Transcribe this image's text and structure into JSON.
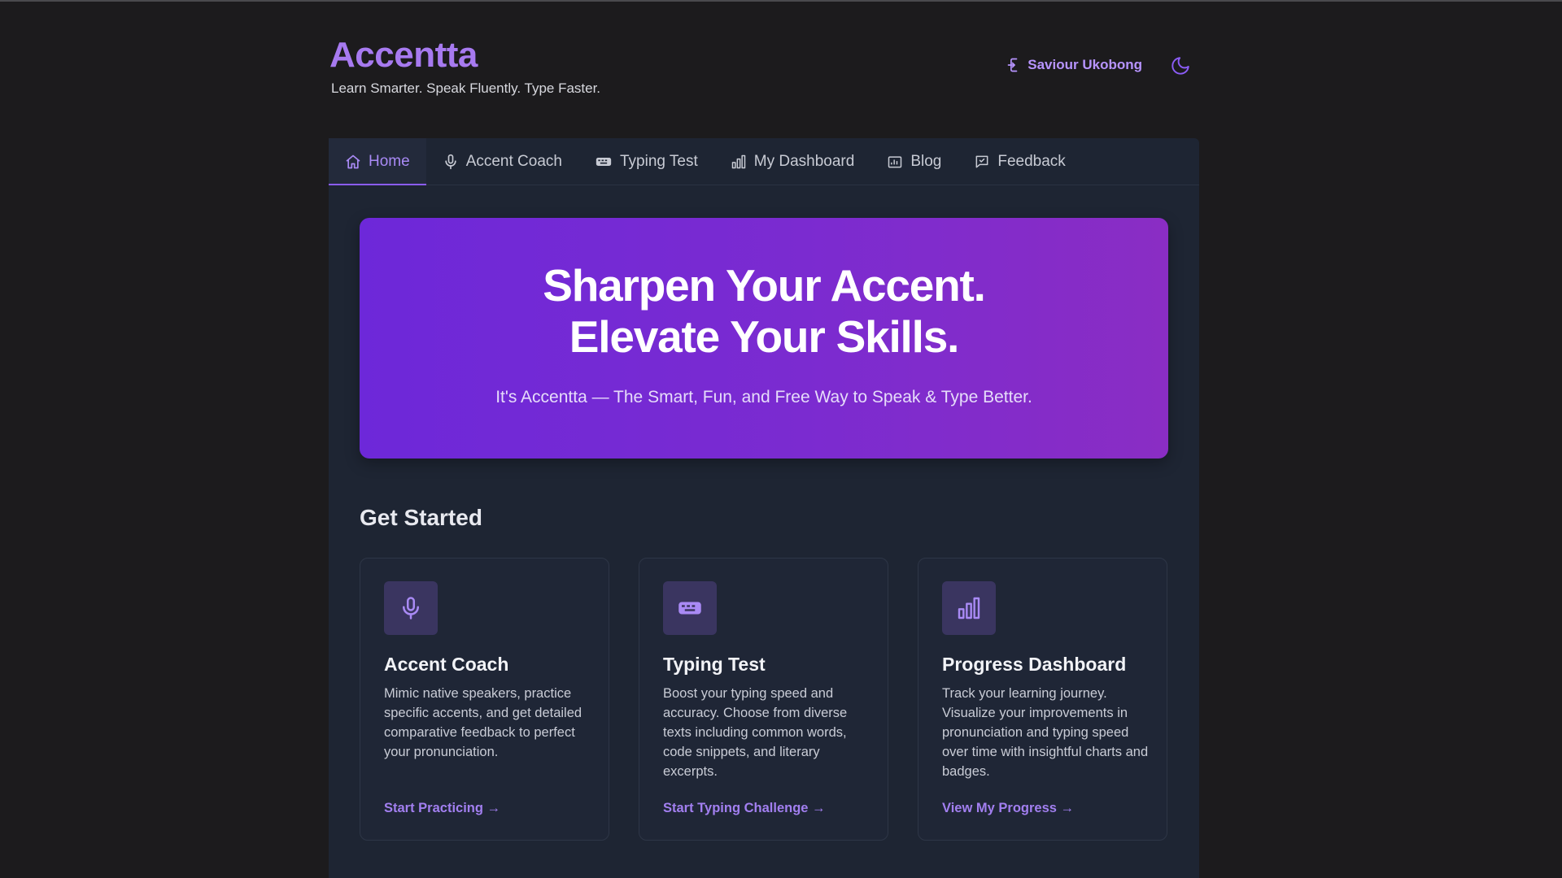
{
  "header": {
    "brand": "Accentta",
    "tagline": "Learn Smarter. Speak Fluently. Type Faster.",
    "user_name": "Saviour Ukobong"
  },
  "nav": {
    "items": [
      {
        "label": "Home",
        "icon": "home-icon",
        "active": true
      },
      {
        "label": "Accent Coach",
        "icon": "microphone-icon"
      },
      {
        "label": "Typing Test",
        "icon": "keyboard-icon"
      },
      {
        "label": "My Dashboard",
        "icon": "bar-chart-icon"
      },
      {
        "label": "Blog",
        "icon": "blog-icon"
      },
      {
        "label": "Feedback",
        "icon": "feedback-icon"
      }
    ]
  },
  "hero": {
    "title_line1": "Sharpen Your Accent.",
    "title_line2": "Elevate Your Skills.",
    "subtitle": "It's Accentta — The Smart, Fun, and Free Way to Speak & Type Better."
  },
  "get_started": {
    "title": "Get Started",
    "cards": [
      {
        "icon": "microphone-icon",
        "title": "Accent Coach",
        "description": "Mimic native speakers, practice specific accents, and get detailed comparative feedback to perfect your pronunciation.",
        "link": "Start Practicing →"
      },
      {
        "icon": "keyboard-icon",
        "title": "Typing Test",
        "description": "Boost your typing speed and accuracy. Choose from diverse texts including common words, code snippets, and literary excerpts.",
        "link": "Start Typing Challenge →"
      },
      {
        "icon": "bar-chart-icon",
        "title": "Progress Dashboard",
        "description": "Track your learning journey. Visualize your improvements in pronunciation and typing speed over time with insightful charts and badges.",
        "link": "View My Progress →"
      }
    ]
  },
  "colors": {
    "accent": "#a77af0",
    "hero_start": "#6d28d9",
    "hero_end": "#8a2dc4",
    "panel": "#1e2533",
    "background": "#1c1b1d"
  }
}
